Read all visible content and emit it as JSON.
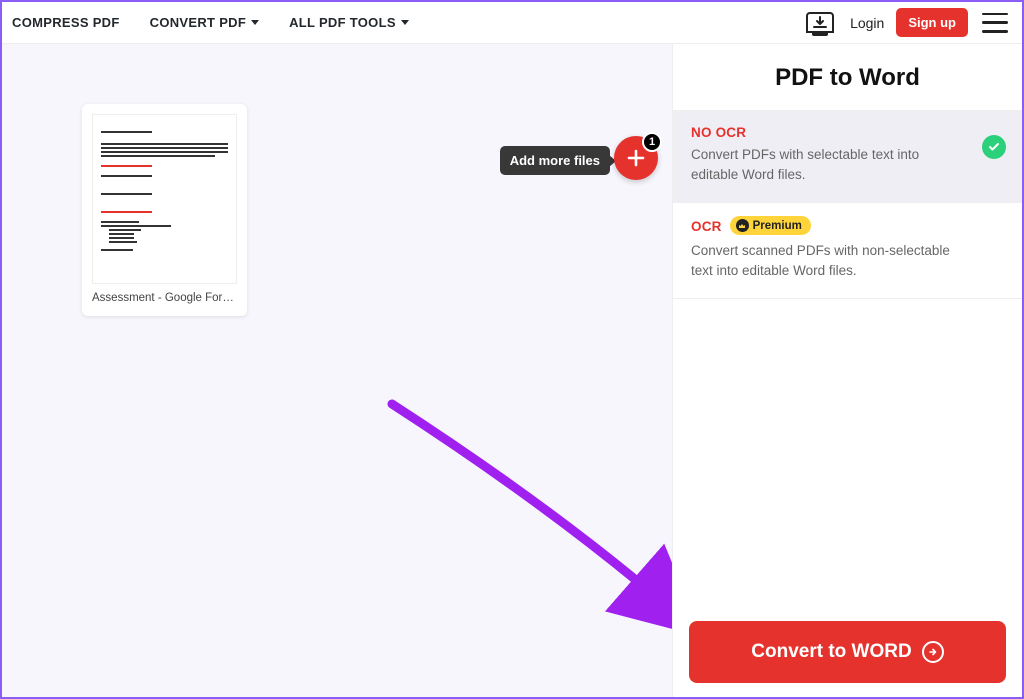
{
  "nav": {
    "compress": "COMPRESS PDF",
    "convert": "CONVERT PDF",
    "all_tools": "ALL PDF TOOLS",
    "login": "Login",
    "signup": "Sign up"
  },
  "add_more": {
    "tooltip": "Add more files",
    "badge_count": "1"
  },
  "file": {
    "name": "Assessment - Google Forms.pdf"
  },
  "panel": {
    "title": "PDF to Word",
    "options": [
      {
        "title": "NO OCR",
        "desc": "Convert PDFs with selectable text into editable Word files.",
        "selected": true,
        "premium": false
      },
      {
        "title": "OCR",
        "desc": "Convert scanned PDFs with non-selectable text into editable Word files.",
        "selected": false,
        "premium": true,
        "premium_label": "Premium"
      }
    ],
    "convert_label": "Convert to WORD"
  }
}
